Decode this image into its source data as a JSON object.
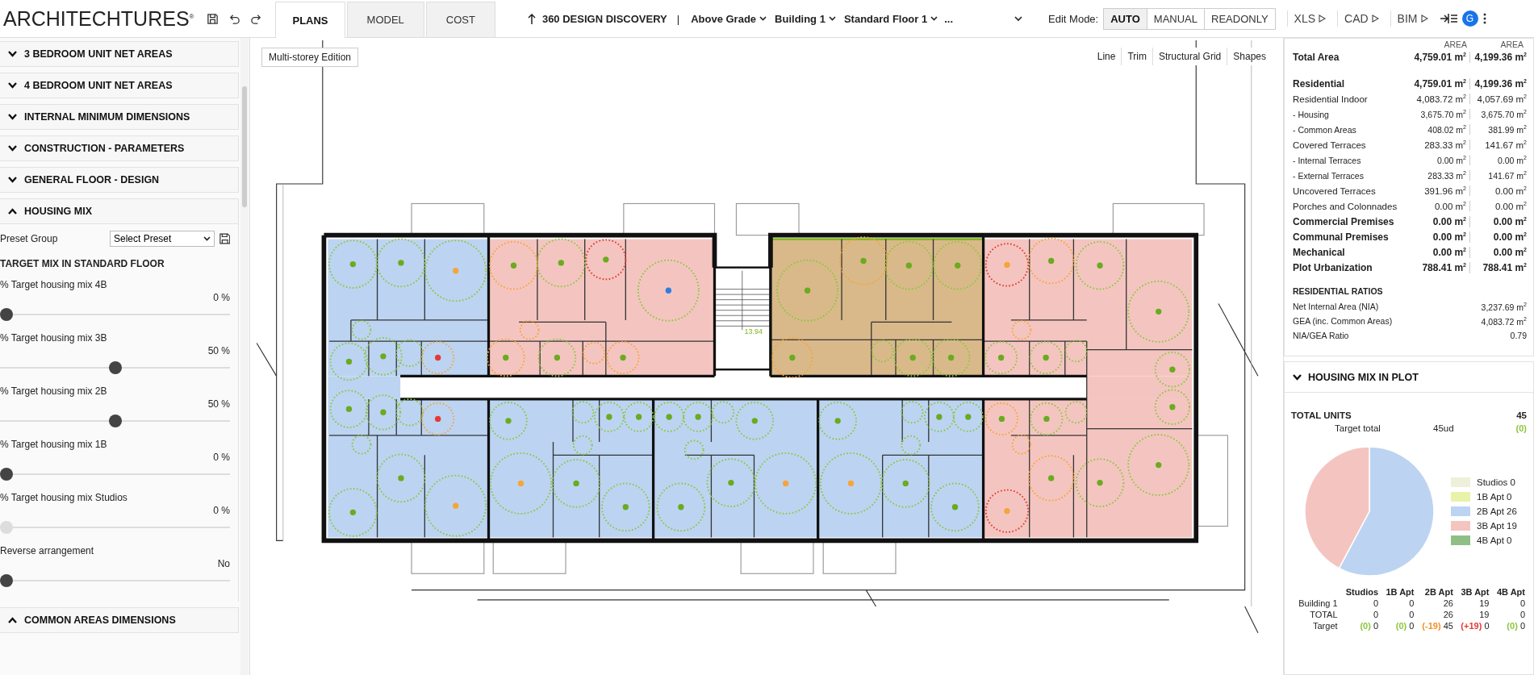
{
  "topbar": {
    "logo": "ARCHITECHTURES$^{®}$",
    "tabs": [
      {
        "label": "PLANS",
        "selected": true
      },
      {
        "label": "MODEL",
        "selected": false
      },
      {
        "label": "COST",
        "selected": false
      }
    ],
    "breadcrumb": {
      "title": "360 DESIGN DISCOVERY",
      "separator": "|",
      "dropdowns": [
        "Above Grade",
        "Building 1",
        "Standard Floor 1"
      ],
      "more": "..."
    },
    "edit_mode": {
      "label": "Edit Mode:",
      "options": [
        {
          "label": "AUTO",
          "selected": true
        },
        {
          "label": "MANUAL",
          "selected": false
        },
        {
          "label": "READONLY",
          "selected": false
        }
      ]
    },
    "exports": [
      "XLS",
      "CAD",
      "BIM"
    ],
    "avatar": "G"
  },
  "sidebar": {
    "sections": [
      {
        "title": "3 BEDROOM UNIT NET AREAS",
        "expanded": false
      },
      {
        "title": "4 BEDROOM UNIT NET AREAS",
        "expanded": false
      },
      {
        "title": "INTERNAL MINIMUM DIMENSIONS",
        "expanded": false
      },
      {
        "title": "CONSTRUCTION - PARAMETERS",
        "expanded": false
      },
      {
        "title": "GENERAL FLOOR - DESIGN",
        "expanded": false
      },
      {
        "title": "HOUSING MIX",
        "expanded": true,
        "content": {
          "preset": {
            "label": "Preset Group",
            "value": "Select Preset"
          },
          "heading": "TARGET MIX IN STANDARD FLOOR",
          "sliders": [
            {
              "label": "% Target housing mix 4B",
              "reading": "0 %",
              "level": 0,
              "disabled": false
            },
            {
              "label": "% Target housing mix 3B",
              "reading": "50 %",
              "level": 0.5,
              "disabled": false
            },
            {
              "label": "% Target housing mix 2B",
              "reading": "50 %",
              "level": 0.5,
              "disabled": false
            },
            {
              "label": "% Target housing mix 1B",
              "reading": "0 %",
              "level": 0,
              "disabled": false
            },
            {
              "label": "% Target housing mix Studios",
              "reading": "0 %",
              "level": 0,
              "disabled": true
            },
            {
              "label": "Reverse arrangement",
              "reading": "No",
              "level": 0,
              "disabled": false
            }
          ]
        }
      },
      {
        "title": "COMMON AREAS DIMENSIONS",
        "expanded": true
      }
    ]
  },
  "canvas": {
    "mode_button": "Multi-storey Edition",
    "tools": [
      "Line",
      "Trim",
      "Structural Grid",
      "Shapes"
    ],
    "stair_label": "13.94"
  },
  "areas": {
    "columns": [
      "AREA",
      "AREA"
    ],
    "total": {
      "label": "Total Area",
      "values": [
        "4,759.01 m$^{2}$",
        "4,199.36 m$^{2}$"
      ]
    },
    "rows": [
      {
        "label": "Residential",
        "kind": "main",
        "values": [
          "4,759.01 m$^{2}$",
          "4,199.36 m$^{2}$"
        ]
      },
      {
        "label": "Residential Indoor",
        "kind": "normal",
        "values": [
          "4,083.72 m$^{2}$",
          "4,057.69 m$^{2}$"
        ]
      },
      {
        "label": "- Housing",
        "kind": "sub",
        "values": [
          "3,675.70 m$^{2}$",
          "3,675.70 m$^{2}$"
        ]
      },
      {
        "label": "- Common Areas",
        "kind": "sub",
        "values": [
          "408.02 m$^{2}$",
          "381.99 m$^{2}$"
        ]
      },
      {
        "label": "Covered Terraces",
        "kind": "normal",
        "values": [
          "283.33 m$^{2}$",
          "141.67 m$^{2}$"
        ]
      },
      {
        "label": "- Internal Terraces",
        "kind": "sub",
        "values": [
          "0.00 m$^{2}$",
          "0.00 m$^{2}$"
        ]
      },
      {
        "label": "- External Terraces",
        "kind": "sub",
        "values": [
          "283.33 m$^{2}$",
          "141.67 m$^{2}$"
        ]
      },
      {
        "label": "Uncovered Terraces",
        "kind": "normal",
        "values": [
          "391.96 m$^{2}$",
          "0.00 m$^{2}$"
        ]
      },
      {
        "label": "Porches and Colonnades",
        "kind": "normal",
        "values": [
          "0.00 m$^{2}$",
          "0.00 m$^{2}$"
        ]
      },
      {
        "label": "Commercial Premises",
        "kind": "main",
        "values": [
          "0.00 m$^{2}$",
          "0.00 m$^{2}$"
        ]
      },
      {
        "label": "Communal Premises",
        "kind": "main",
        "values": [
          "0.00 m$^{2}$",
          "0.00 m$^{2}$"
        ]
      },
      {
        "label": "Mechanical",
        "kind": "main",
        "values": [
          "0.00 m$^{2}$",
          "0.00 m$^{2}$"
        ]
      },
      {
        "label": "Plot Urbanization",
        "kind": "main",
        "values": [
          "788.41 m$^{2}$",
          "788.41 m$^{2}$"
        ]
      }
    ],
    "ratios": {
      "heading": "RESIDENTIAL RATIOS",
      "rows": [
        {
          "label": "Net Internal Area (NIA)",
          "value": "3,237.69 m$^{2}$"
        },
        {
          "label": "GEA (inc. Common Areas)",
          "value": "4,083.72 m$^{2}$"
        },
        {
          "label": "NIA/GEA Ratio",
          "value": "0.79"
        }
      ]
    }
  },
  "housing_mix": {
    "title": "HOUSING MIX IN PLOT",
    "expanded": true,
    "total": {
      "label": "TOTAL UNITS",
      "value": "45"
    },
    "target": {
      "label": "Target total",
      "value": "45ud",
      "delta": "(0)",
      "color": "#8dc63f"
    },
    "chart_data": {
      "type": "pie",
      "categories": [
        "Studios 0",
        "1B Apt 0",
        "2B Apt 26",
        "3B Apt 19",
        "4B Apt 0"
      ],
      "series": [
        {
          "values": [
            0,
            0,
            26,
            19,
            0
          ]
        }
      ]
    },
    "legend": [
      {
        "color": "#eef0dc"
      },
      {
        "color": "#e8f2a8"
      },
      {
        "color": "#bcd4f2"
      },
      {
        "color": "#f4c5c0"
      },
      {
        "color": "#8fbf85"
      }
    ],
    "table": {
      "columns": [
        "Studios",
        "1B Apt",
        "2B Apt",
        "3B Apt",
        "4B Apt"
      ],
      "rows": [
        {
          "label": "Building 1",
          "cells": [
            {
              "value": "0"
            },
            {
              "value": "0"
            },
            {
              "value": "26"
            },
            {
              "value": "19"
            },
            {
              "value": "0"
            }
          ]
        },
        {
          "label": "TOTAL",
          "cells": [
            {
              "value": "0"
            },
            {
              "value": "0"
            },
            {
              "value": "26"
            },
            {
              "value": "19"
            },
            {
              "value": "0"
            }
          ]
        },
        {
          "label": "Target",
          "cells": [
            {
              "delta": "(0)",
              "color": "#8dc63f",
              "value": "0"
            },
            {
              "delta": "(0)",
              "color": "#8dc63f",
              "value": "0"
            },
            {
              "delta": "(-19)",
              "color": "#f0902a",
              "value": "45"
            },
            {
              "delta": "(+19)",
              "color": "#e53935",
              "value": "0"
            },
            {
              "delta": "(0)",
              "color": "#8dc63f",
              "value": "0"
            }
          ]
        }
      ]
    }
  }
}
